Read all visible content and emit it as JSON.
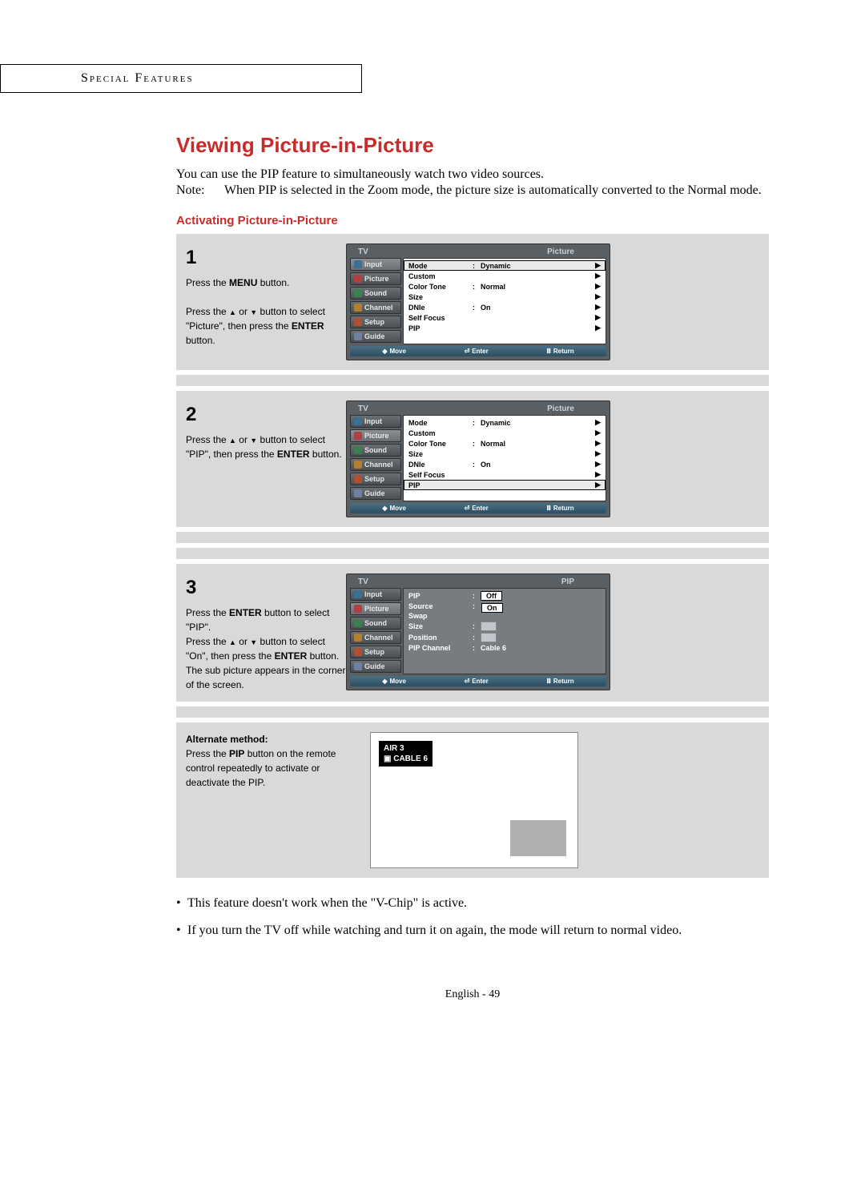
{
  "section_header": "Special Features",
  "title": "Viewing Picture-in-Picture",
  "intro": "You can use the PIP feature to simultaneously watch two video sources.",
  "note_label": "Note:",
  "note_text": "When PIP is selected in the Zoom mode, the picture size is automatically converted to the Normal mode.",
  "subhead": "Activating Picture-in-Picture",
  "steps": {
    "s1": {
      "num": "1",
      "line1": "Press the ",
      "btn1": "MENU",
      "line1b": " button.",
      "line2a": "Press the ",
      "line2b": " or ",
      "line2c": " button to select \"Picture\", then press the ",
      "btn2": "ENTER",
      "line2d": " button."
    },
    "s2": {
      "num": "2",
      "line1a": "Press the ",
      "line1b": " or ",
      "line1c": " button to select \"PIP\", then press the ",
      "btn1": "ENTER",
      "line1d": " button."
    },
    "s3": {
      "num": "3",
      "line1a": "Press the ",
      "btn1": "ENTER",
      "line1b": " button to select \"PIP\".",
      "line2a": "Press the ",
      "line2b": " or ",
      "line2c": " button to select \"On\", then press the ",
      "btn2": "ENTER",
      "line2d": " button.",
      "line3": "The sub picture appears in the corner of the screen."
    }
  },
  "osd": {
    "tv": "TV",
    "picture_title": "Picture",
    "pip_title": "PIP",
    "tabs": {
      "input": "Input",
      "picture": "Picture",
      "sound": "Sound",
      "channel": "Channel",
      "setup": "Setup",
      "guide": "Guide"
    },
    "picture_menu": {
      "mode": {
        "label": "Mode",
        "value": "Dynamic"
      },
      "custom": {
        "label": "Custom"
      },
      "colortone": {
        "label": "Color Tone",
        "value": "Normal"
      },
      "size": {
        "label": "Size"
      },
      "dnie": {
        "label": "DNIe",
        "value": "On"
      },
      "selffocus": {
        "label": "Self Focus"
      },
      "pip": {
        "label": "PIP"
      }
    },
    "pip_menu": {
      "pip": {
        "label": "PIP",
        "off": "Off",
        "on": "On"
      },
      "source": {
        "label": "Source"
      },
      "swap": {
        "label": "Swap"
      },
      "size": {
        "label": "Size"
      },
      "position": {
        "label": "Position"
      },
      "channel": {
        "label": "PIP Channel",
        "value": "Cable  6"
      }
    },
    "footer": {
      "move": "Move",
      "enter": "Enter",
      "return": "Return"
    }
  },
  "alternate": {
    "head": "Alternate method:",
    "line1a": "Press the ",
    "btn": "PIP",
    "line1b": " button on the remote control repeatedly to activate or deactivate the PIP."
  },
  "tv_preview": {
    "line1": "AIR 3",
    "line2": "CABLE  6"
  },
  "notes": {
    "n1": "This feature doesn't work when the \"V-Chip\" is active.",
    "n2": "If you turn the TV off while watching and turn it on again, the mode will return to normal video."
  },
  "page_footer": "English - 49",
  "glyphs": {
    "up": "▲",
    "down": "▼",
    "right": "▶",
    "updown": "◆",
    "enter_icon": "⏎",
    "return_icon": "Ⅲ",
    "pip_icon": "▣"
  }
}
